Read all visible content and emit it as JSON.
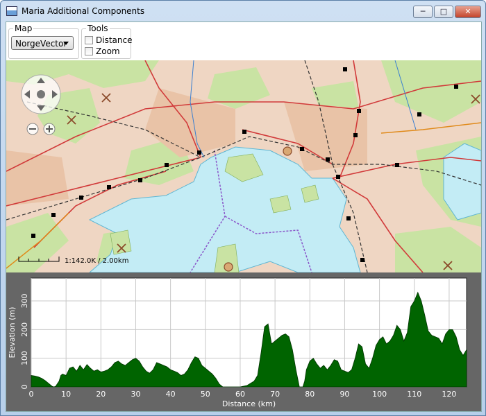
{
  "window": {
    "title": "Maria Additional Components"
  },
  "toolbar": {
    "map_group_label": "Map",
    "map_selected": "NorgeVector",
    "tools_group_label": "Tools",
    "distance_label": "Distance",
    "zoom_label": "Zoom"
  },
  "map": {
    "scale_text": "1:142.0K / 2.00km"
  },
  "chart_data": {
    "type": "area",
    "title": "",
    "xlabel": "Distance (km)",
    "ylabel": "Elevation (m)",
    "xlim": [
      0,
      125
    ],
    "ylim": [
      0,
      380
    ],
    "x_ticks": [
      "0",
      "10",
      "20",
      "30",
      "40",
      "50",
      "60",
      "70",
      "80",
      "90",
      "100",
      "110",
      "120"
    ],
    "y_ticks": [
      "0",
      "100",
      "200",
      "300"
    ],
    "grid": true,
    "fill_color": "#006400",
    "series": [
      {
        "x": [
          0,
          1,
          2,
          3,
          4,
          5,
          6,
          6.5,
          7,
          8,
          8.5,
          9,
          10,
          11,
          12,
          13,
          14,
          15,
          16,
          17,
          18,
          19,
          20,
          21,
          22,
          23,
          24,
          25,
          26,
          27,
          28,
          29,
          30,
          31,
          32,
          33,
          34,
          35,
          36,
          37,
          38,
          39,
          40,
          41,
          42,
          43,
          44,
          45,
          46,
          47,
          48,
          49,
          50,
          51,
          52,
          53,
          54,
          55,
          56,
          57,
          57.5,
          58,
          60,
          62,
          64,
          65,
          66,
          67,
          68,
          69,
          70,
          71,
          72,
          73,
          74,
          75,
          76,
          77,
          78,
          78.5,
          79,
          80,
          81,
          82,
          83,
          84,
          85,
          86,
          87,
          88,
          89,
          90,
          91,
          92,
          93,
          94,
          95,
          96,
          97,
          98,
          99,
          100,
          101,
          102,
          103,
          104,
          105,
          106,
          107,
          108,
          109,
          110,
          111,
          112,
          113,
          114,
          115,
          116,
          117,
          118,
          119,
          120,
          121,
          122,
          123,
          124,
          125
        ],
        "y": [
          40,
          38,
          35,
          30,
          22,
          12,
          2,
          0,
          2,
          20,
          40,
          45,
          40,
          65,
          70,
          55,
          75,
          60,
          78,
          65,
          55,
          60,
          52,
          55,
          60,
          70,
          85,
          90,
          80,
          75,
          85,
          95,
          100,
          90,
          70,
          55,
          48,
          60,
          85,
          80,
          75,
          70,
          60,
          55,
          50,
          40,
          45,
          60,
          85,
          105,
          100,
          75,
          65,
          55,
          45,
          30,
          10,
          0,
          0,
          0,
          0,
          0,
          0,
          5,
          20,
          40,
          120,
          210,
          220,
          150,
          160,
          170,
          180,
          185,
          175,
          130,
          60,
          0,
          0,
          20,
          60,
          90,
          100,
          80,
          65,
          75,
          60,
          75,
          95,
          90,
          60,
          55,
          50,
          60,
          100,
          150,
          140,
          80,
          65,
          100,
          145,
          165,
          175,
          150,
          160,
          180,
          215,
          200,
          160,
          190,
          280,
          300,
          330,
          300,
          250,
          195,
          180,
          175,
          170,
          150,
          185,
          200,
          200,
          175,
          130,
          110,
          130
        ]
      }
    ]
  }
}
